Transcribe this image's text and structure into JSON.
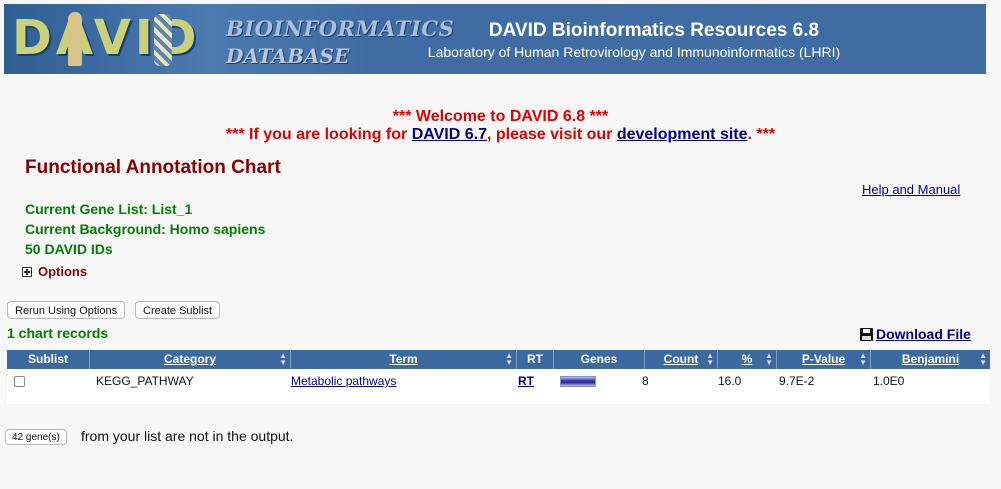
{
  "header": {
    "logo_letters": "DAVID",
    "logo_line1": "BIOINFORMATICS",
    "logo_line2": "DATABASE",
    "title": "DAVID Bioinformatics Resources 6.8",
    "subtitle": "Laboratory of Human Retrovirology and Immunoinformatics (LHRI)"
  },
  "welcome": {
    "line1": "*** Welcome to DAVID 6.8 ***",
    "line2_pre": "*** If you are looking for ",
    "line2_link1": "DAVID 6.7",
    "line2_mid": ", please visit our ",
    "line2_link2": "development site",
    "line2_post": ". ***"
  },
  "page": {
    "title": "Functional Annotation Chart",
    "help_link": "Help and Manual",
    "current_gene_list": "Current Gene List: List_1",
    "current_background": "Current Background: Homo sapiens",
    "id_count": "50 DAVID IDs",
    "options_label": "Options"
  },
  "toolbar": {
    "rerun_label": "Rerun Using Options",
    "create_sublist_label": "Create Sublist"
  },
  "records_label": "1 chart records",
  "download_label": "Download File",
  "table": {
    "headers": {
      "sublist": "Sublist",
      "category": "Category",
      "term": "Term",
      "rt": "RT",
      "genes": "Genes",
      "count": "Count",
      "percent": "%",
      "pvalue": "P-Value",
      "benjamini": "Benjamini"
    },
    "rows": [
      {
        "checked": false,
        "category": "KEGG_PATHWAY",
        "term": "Metabolic pathways",
        "rt": "RT",
        "count": "8",
        "percent": "16.0",
        "pvalue": "9.7E-2",
        "benjamini": "1.0E0"
      }
    ]
  },
  "footer": {
    "genes_button": "42 gene(s)",
    "genes_text": "from your list are not in the output."
  },
  "colors": {
    "header_bg": "#3e6ca3",
    "table_header_bg": "#3c6a9f",
    "welcome_red": "#e00000",
    "title_red": "#8b0000",
    "info_green": "#008000",
    "link_blue": "#00008b"
  }
}
